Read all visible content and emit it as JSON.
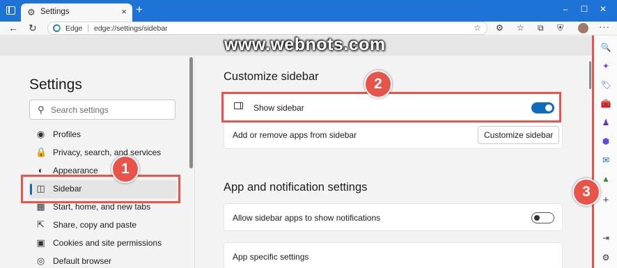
{
  "browser": {
    "tab_title": "Settings",
    "new_tab": "+",
    "window_controls": {
      "minimize": "–",
      "maximize": "☐",
      "close": "✕"
    },
    "omnibox": {
      "brand": "Edge",
      "separator": "|",
      "url": "edge://settings/sidebar"
    }
  },
  "watermark": "www.webnots.com",
  "settings": {
    "title": "Settings",
    "search_placeholder": "Search settings",
    "nav": [
      {
        "label": "Profiles",
        "icon": "person-icon"
      },
      {
        "label": "Privacy, search, and services",
        "icon": "lock-icon"
      },
      {
        "label": "Appearance",
        "icon": "palette-icon"
      },
      {
        "label": "Sidebar",
        "icon": "sidebar-icon",
        "selected": true
      },
      {
        "label": "Start, home, and new tabs",
        "icon": "home-icon"
      },
      {
        "label": "Share, copy and paste",
        "icon": "share-icon"
      },
      {
        "label": "Cookies and site permissions",
        "icon": "cookie-icon"
      },
      {
        "label": "Default browser",
        "icon": "browser-icon"
      }
    ]
  },
  "main": {
    "section1_title": "Customize sidebar",
    "show_sidebar_label": "Show sidebar",
    "show_sidebar_on": true,
    "add_remove_label": "Add or remove apps from sidebar",
    "customize_button": "Customize sidebar",
    "section2_title": "App and notification settings",
    "allow_notifications_label": "Allow sidebar apps to show notifications",
    "allow_notifications_on": false,
    "app_specific_label": "App specific settings"
  },
  "badges": {
    "b1": "1",
    "b2": "2",
    "b3": "3"
  },
  "right_sidebar": [
    {
      "name": "search-icon",
      "glyph": "🔍",
      "color": "#1a5fb4"
    },
    {
      "name": "copilot-icon",
      "glyph": "✦",
      "color": "#7b3fe4"
    },
    {
      "name": "shopping-tag-icon",
      "glyph": "🏷",
      "color": "#1e73d6"
    },
    {
      "name": "tools-icon",
      "glyph": "🧰",
      "color": "#2b7a3d"
    },
    {
      "name": "games-icon",
      "glyph": "♟",
      "color": "#6a2fc4"
    },
    {
      "name": "microsoft-365-icon",
      "glyph": "⬢",
      "color": "#5b4fd6"
    },
    {
      "name": "outlook-icon",
      "glyph": "✉",
      "color": "#0f6cbd"
    },
    {
      "name": "tree-icon",
      "glyph": "▲",
      "color": "#2e8b3a"
    },
    {
      "name": "add-app-icon",
      "glyph": "+",
      "color": "#444444"
    }
  ],
  "colors": {
    "accent": "#0f6cbd",
    "titlebar": "#1e73d6",
    "highlight": "#e8534a"
  }
}
